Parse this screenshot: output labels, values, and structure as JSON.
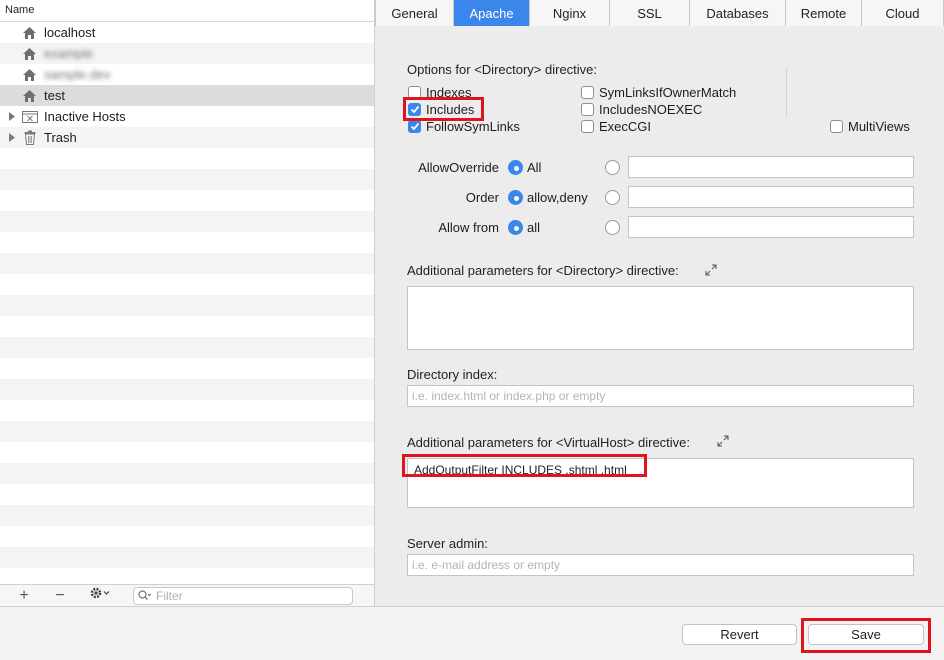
{
  "sidebar": {
    "header": "Name",
    "hosts": [
      {
        "label": "localhost",
        "icon": "home-icon",
        "blurred": false
      },
      {
        "label": "example",
        "icon": "home-icon",
        "blurred": true
      },
      {
        "label": "sample.dev",
        "icon": "home-icon",
        "blurred": true
      },
      {
        "label": "test",
        "icon": "home-icon",
        "blurred": false,
        "selected": true
      },
      {
        "label": "Inactive Hosts",
        "icon": "inactive-folder-icon",
        "blurred": false
      },
      {
        "label": "Trash",
        "icon": "trash-icon",
        "blurred": false
      }
    ],
    "footer": {
      "add": "+",
      "remove": "−",
      "filter_placeholder": "Filter"
    }
  },
  "tabs": [
    "General",
    "Apache",
    "Nginx",
    "SSL",
    "Databases",
    "Remote",
    "Cloud"
  ],
  "active_tab": "Apache",
  "apache": {
    "options_label": "Options for <Directory> directive:",
    "options": {
      "indexes": {
        "label": "Indexes",
        "checked": false
      },
      "includes": {
        "label": "Includes",
        "checked": true
      },
      "follow_symlinks": {
        "label": "FollowSymLinks",
        "checked": true
      },
      "symlinks_owner": {
        "label": "SymLinksIfOwnerMatch",
        "checked": false
      },
      "includes_noexec": {
        "label": "IncludesNOEXEC",
        "checked": false
      },
      "exec_cgi": {
        "label": "ExecCGI",
        "checked": false
      },
      "multiviews": {
        "label": "MultiViews",
        "checked": false
      }
    },
    "allow_override": {
      "label": "AllowOverride",
      "option": "All",
      "custom": ""
    },
    "order": {
      "label": "Order",
      "option": "allow,deny",
      "custom": ""
    },
    "allow_from": {
      "label": "Allow from",
      "option": "all",
      "custom": ""
    },
    "dir_params_label": "Additional parameters for <Directory> directive:",
    "dir_params_value": "",
    "dir_index_label": "Directory index:",
    "dir_index_placeholder": "i.e. index.html or index.php or empty",
    "vhost_params_label": "Additional parameters for <VirtualHost> directive:",
    "vhost_params_value": "AddOutputFilter INCLUDES .shtml .html",
    "server_admin_label": "Server admin:",
    "server_admin_placeholder": "i.e. e-mail address or empty"
  },
  "buttons": {
    "revert": "Revert",
    "save": "Save"
  },
  "colors": {
    "accent": "#3b86ea",
    "highlight": "#e0141e"
  }
}
